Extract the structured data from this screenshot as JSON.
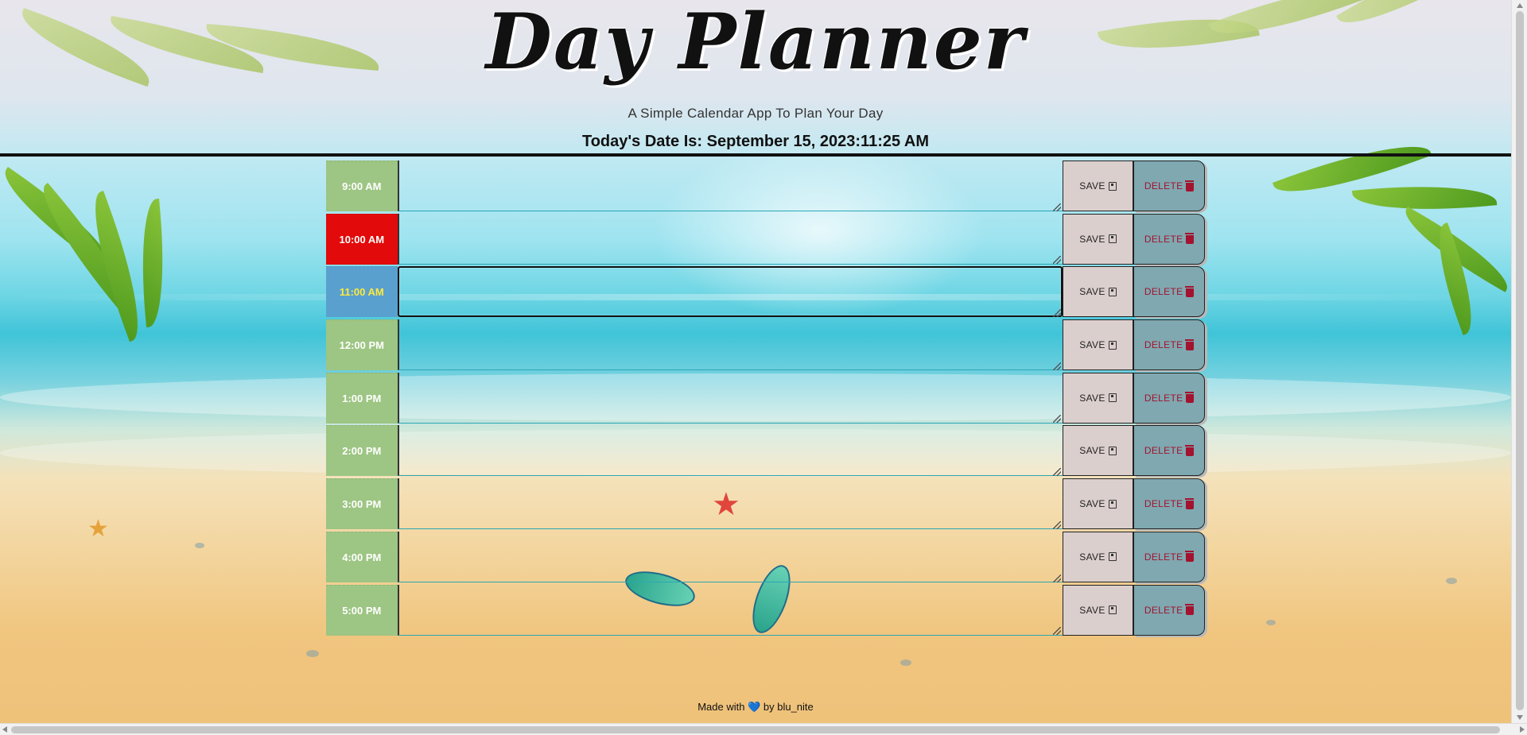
{
  "header": {
    "title": "Day Planner",
    "subtitle": "A Simple Calendar App To Plan Your Day",
    "current_day": "Today's Date Is: September 15, 2023:11:25 AM"
  },
  "timeblocks": [
    {
      "hour": "9:00 AM",
      "state": "past",
      "text": "",
      "save_label": "SAVE",
      "delete_label": "DELETE"
    },
    {
      "hour": "10:00 AM",
      "state": "past-red",
      "text": "",
      "save_label": "SAVE",
      "delete_label": "DELETE"
    },
    {
      "hour": "11:00 AM",
      "state": "present",
      "text": "",
      "save_label": "SAVE",
      "delete_label": "DELETE"
    },
    {
      "hour": "12:00 PM",
      "state": "future",
      "text": "",
      "save_label": "SAVE",
      "delete_label": "DELETE"
    },
    {
      "hour": "1:00 PM",
      "state": "future",
      "text": "",
      "save_label": "SAVE",
      "delete_label": "DELETE"
    },
    {
      "hour": "2:00 PM",
      "state": "future",
      "text": "",
      "save_label": "SAVE",
      "delete_label": "DELETE"
    },
    {
      "hour": "3:00 PM",
      "state": "future",
      "text": "",
      "save_label": "SAVE",
      "delete_label": "DELETE"
    },
    {
      "hour": "4:00 PM",
      "state": "future",
      "text": "",
      "save_label": "SAVE",
      "delete_label": "DELETE"
    },
    {
      "hour": "5:00 PM",
      "state": "future",
      "text": "",
      "save_label": "SAVE",
      "delete_label": "DELETE"
    }
  ],
  "icons": {
    "save": "floppy-disk-icon",
    "delete": "trash-can-icon",
    "heart": "heart-icon"
  },
  "footer": {
    "made_with": "Made with",
    "heart": "💙",
    "by": "by blu_nite"
  },
  "colors": {
    "hour_past": "#9dc583",
    "hour_red": "#e20a0a",
    "hour_present": "#5aa0cf",
    "present_text": "#ffea3a",
    "save_bg": "#dbcfcd",
    "delete_bg": "#7fa8b0",
    "delete_text": "#a3132f"
  }
}
